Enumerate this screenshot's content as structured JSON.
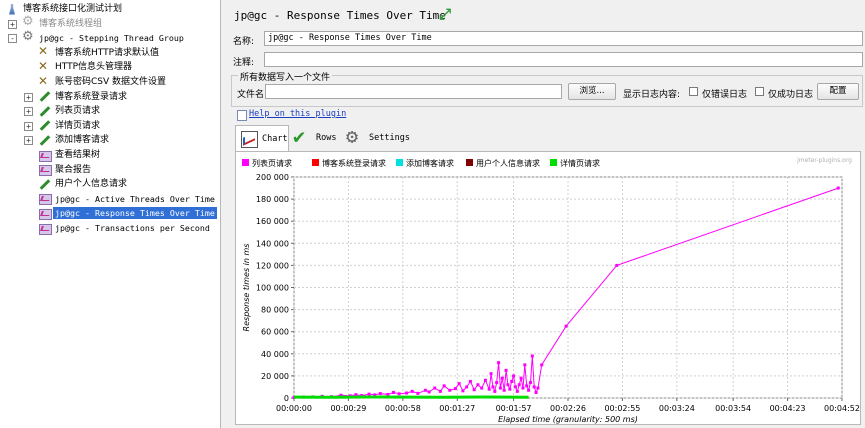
{
  "tree": {
    "items": [
      {
        "label": "博客系统接口化测试计划",
        "icon": "flask-icon",
        "depth": 0,
        "expander": "none",
        "mono": false,
        "dim": false,
        "selected": false
      },
      {
        "label": "博客系统线程组",
        "icon": "gear-icon",
        "depth": 1,
        "expander": "+",
        "mono": false,
        "dim": true,
        "selected": false
      },
      {
        "label": "jp@gc - Stepping Thread Group",
        "icon": "gear-icon",
        "depth": 1,
        "expander": "-",
        "mono": true,
        "dim": false,
        "selected": false
      },
      {
        "label": "博客系统HTTP请求默认值",
        "icon": "tools-icon",
        "depth": 2,
        "expander": "none",
        "mono": false,
        "dim": false,
        "selected": false
      },
      {
        "label": "HTTP信息头管理器",
        "icon": "tools-icon",
        "depth": 2,
        "expander": "none",
        "mono": false,
        "dim": false,
        "selected": false
      },
      {
        "label": "账号密码CSV 数据文件设置",
        "icon": "tools-icon",
        "depth": 2,
        "expander": "none",
        "mono": false,
        "dim": false,
        "selected": false
      },
      {
        "label": "博客系统登录请求",
        "icon": "pen-icon",
        "depth": 2,
        "expander": "+",
        "mono": false,
        "dim": false,
        "selected": false
      },
      {
        "label": "列表页请求",
        "icon": "pen-icon",
        "depth": 2,
        "expander": "+",
        "mono": false,
        "dim": false,
        "selected": false
      },
      {
        "label": "详情页请求",
        "icon": "pen-icon",
        "depth": 2,
        "expander": "+",
        "mono": false,
        "dim": false,
        "selected": false
      },
      {
        "label": "添加博客请求",
        "icon": "pen-icon",
        "depth": 2,
        "expander": "+",
        "mono": false,
        "dim": false,
        "selected": false
      },
      {
        "label": "查看结果树",
        "icon": "listener-icon",
        "depth": 2,
        "expander": "none",
        "mono": false,
        "dim": false,
        "selected": false
      },
      {
        "label": "聚合报告",
        "icon": "listener-icon",
        "depth": 2,
        "expander": "none",
        "mono": false,
        "dim": false,
        "selected": false
      },
      {
        "label": "用户个人信息请求",
        "icon": "pen-icon",
        "depth": 2,
        "expander": "none",
        "mono": false,
        "dim": false,
        "selected": false
      },
      {
        "label": "jp@gc - Active Threads Over Time",
        "icon": "listener-icon",
        "depth": 2,
        "expander": "none",
        "mono": true,
        "dim": false,
        "selected": false
      },
      {
        "label": "jp@gc - Response Times Over Time",
        "icon": "listener-icon",
        "depth": 2,
        "expander": "none",
        "mono": true,
        "dim": false,
        "selected": true
      },
      {
        "label": "jp@gc - Transactions per Second",
        "icon": "listener-icon",
        "depth": 2,
        "expander": "none",
        "mono": true,
        "dim": false,
        "selected": false
      }
    ]
  },
  "header": {
    "title": "jp@gc - Response Times Over Time",
    "expand_icon": "expand-icon"
  },
  "form": {
    "name_label": "名称:",
    "name_value": "jp@gc - Response Times Over Time",
    "comment_label": "注释:",
    "comment_value": "",
    "file_group_label": "所有数据写入一个文件",
    "filename_label": "文件名",
    "filename_value": "",
    "browse_label": "浏览...",
    "log_content_label": "显示日志内容:",
    "errors_only_label": "仅错误日志",
    "success_only_label": "仅成功日志",
    "configure_label": "配置"
  },
  "help": {
    "link_text": "Help on this plugin"
  },
  "tabs": [
    {
      "label": "Chart",
      "icon": "chart-icon",
      "active": true
    },
    {
      "label": "Rows",
      "icon": "checkmark-icon",
      "active": false
    },
    {
      "label": "Settings",
      "icon": "gear-icon",
      "active": false
    }
  ],
  "chart_data": {
    "type": "line",
    "watermark": "jmeter-plugins.org",
    "xlabel": "Elapsed time (granularity: 500 ms)",
    "ylabel": "Response times in ms",
    "xlim": [
      0,
      292
    ],
    "ylim": [
      0,
      200000
    ],
    "x_unit": "seconds",
    "xticks": [
      {
        "value": 0,
        "label": "00:00:00"
      },
      {
        "value": 29,
        "label": "00:00:29"
      },
      {
        "value": 58,
        "label": "00:00:58"
      },
      {
        "value": 87,
        "label": "00:01:27"
      },
      {
        "value": 117,
        "label": "00:01:57"
      },
      {
        "value": 146,
        "label": "00:02:26"
      },
      {
        "value": 175,
        "label": "00:02:55"
      },
      {
        "value": 204,
        "label": "00:03:24"
      },
      {
        "value": 234,
        "label": "00:03:54"
      },
      {
        "value": 263,
        "label": "00:04:23"
      },
      {
        "value": 292,
        "label": "00:04:52"
      }
    ],
    "yticks": [
      {
        "value": 0,
        "label": "0"
      },
      {
        "value": 20000,
        "label": "20 000"
      },
      {
        "value": 40000,
        "label": "40 000"
      },
      {
        "value": 60000,
        "label": "60 000"
      },
      {
        "value": 80000,
        "label": "80 000"
      },
      {
        "value": 100000,
        "label": "100 000"
      },
      {
        "value": 120000,
        "label": "120 000"
      },
      {
        "value": 140000,
        "label": "140 000"
      },
      {
        "value": 160000,
        "label": "160 000"
      },
      {
        "value": 180000,
        "label": "180 000"
      },
      {
        "value": 200000,
        "label": "200 000"
      }
    ],
    "grid": true,
    "legend_position": "top-left",
    "series": [
      {
        "name": "列表页请求",
        "color": "#ff00ff",
        "markers": true,
        "x": [
          0,
          5,
          10,
          15,
          20,
          25,
          30,
          33,
          36,
          40,
          43,
          46,
          50,
          53,
          56,
          60,
          63,
          66,
          70,
          72,
          75,
          78,
          80,
          83,
          86,
          88,
          90,
          92,
          94,
          96,
          98,
          100,
          102,
          104,
          105,
          106,
          107,
          108,
          109,
          110,
          111,
          112,
          113,
          114,
          115,
          116,
          117,
          118,
          119,
          120,
          121,
          122,
          123,
          124,
          125,
          126,
          127,
          128,
          129,
          130,
          132,
          145,
          172,
          290
        ],
        "y": [
          500,
          800,
          1000,
          1500,
          1200,
          2500,
          2000,
          3000,
          2200,
          3500,
          2800,
          4000,
          3200,
          5000,
          3800,
          4500,
          6000,
          4200,
          7000,
          5500,
          9000,
          6000,
          11000,
          7000,
          8500,
          13000,
          6500,
          10000,
          15000,
          7500,
          12000,
          9000,
          16000,
          8000,
          22000,
          10000,
          6000,
          14000,
          32000,
          9000,
          18000,
          7000,
          25000,
          12000,
          8000,
          15000,
          20000,
          10000,
          6000,
          12000,
          18000,
          9000,
          30000,
          11000,
          7000,
          14000,
          38000,
          10000,
          5000,
          9000,
          30000,
          65000,
          120000,
          190000
        ]
      },
      {
        "name": "博客系统登录请求",
        "color": "#ff0000",
        "markers": false,
        "x": [],
        "y": []
      },
      {
        "name": "添加博客请求",
        "color": "#00e0e0",
        "markers": false,
        "x": [],
        "y": []
      },
      {
        "name": "用户个人信息请求",
        "color": "#800000",
        "markers": false,
        "x": [],
        "y": []
      },
      {
        "name": "详情页请求",
        "color": "#00dd00",
        "markers": false,
        "x": [
          0,
          20,
          40,
          60,
          80,
          100,
          115,
          125
        ],
        "y": [
          800,
          700,
          900,
          800,
          700,
          900,
          800,
          600
        ]
      }
    ]
  }
}
